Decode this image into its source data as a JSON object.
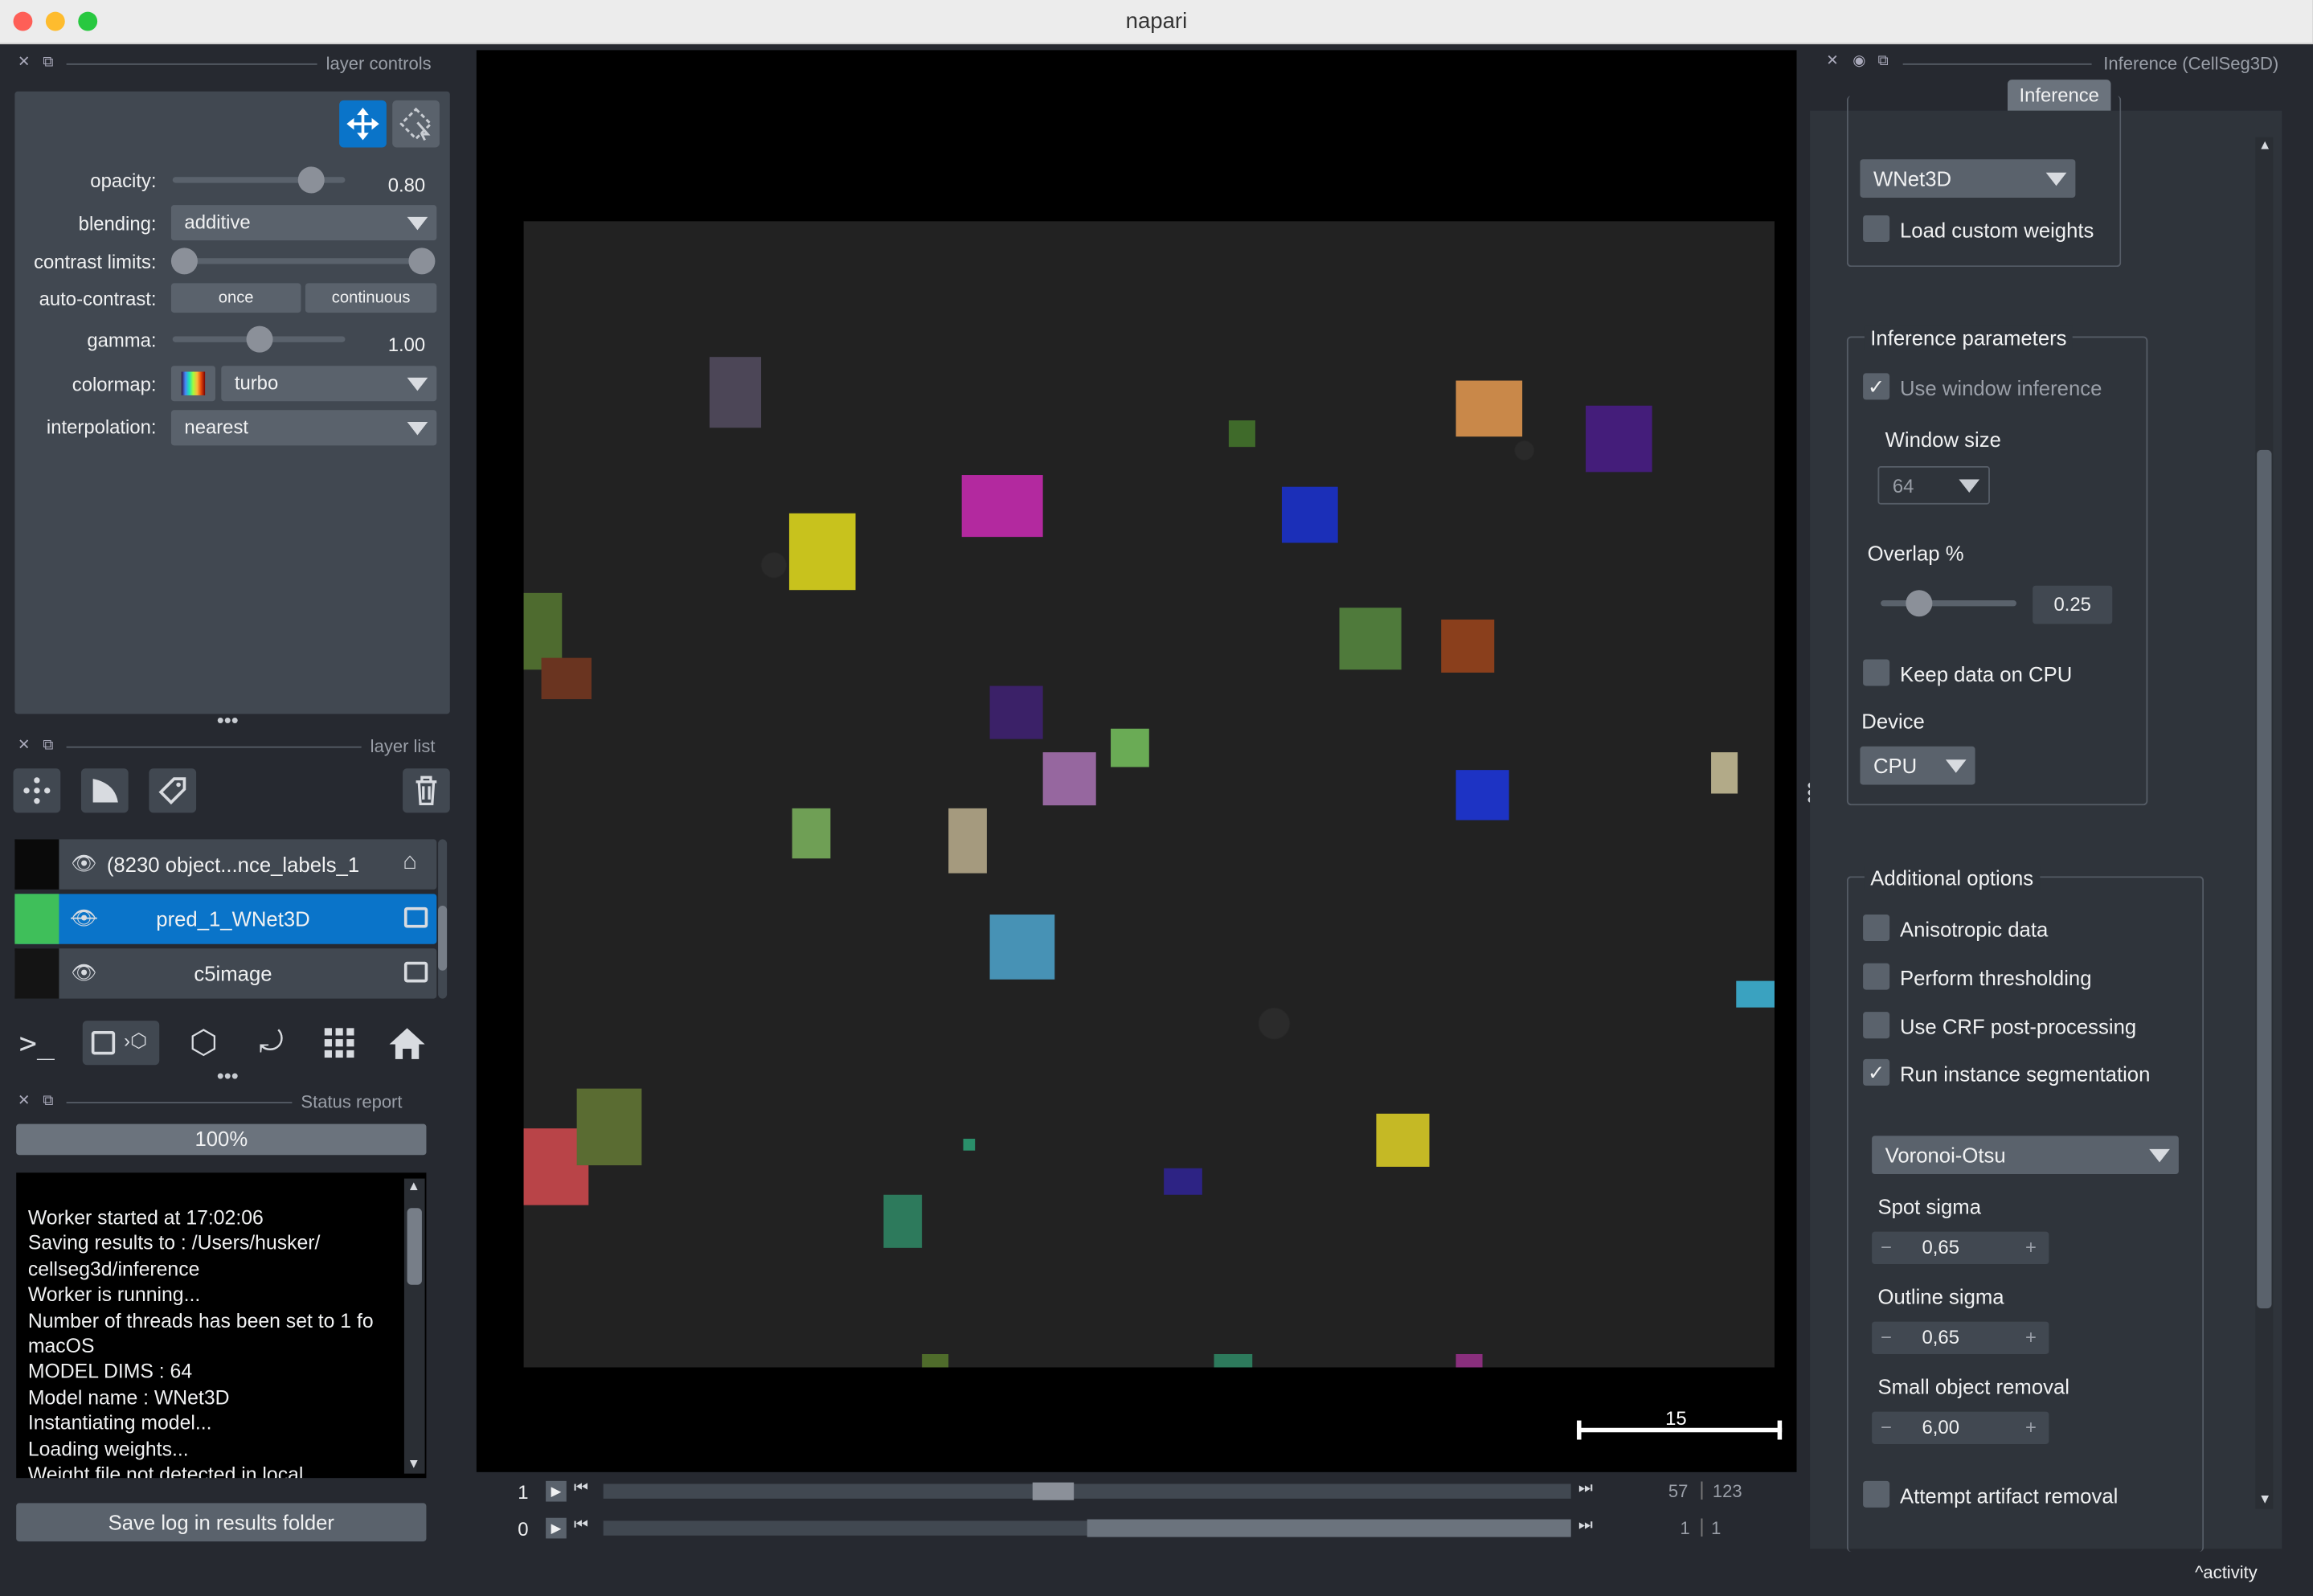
{
  "window": {
    "title": "napari"
  },
  "layer_controls": {
    "header": "layer controls",
    "opacity": {
      "label": "opacity:",
      "value": "0.80",
      "fraction": 0.8
    },
    "blending": {
      "label": "blending:",
      "value": "additive"
    },
    "contrast_limits": {
      "label": "contrast limits:"
    },
    "auto_contrast": {
      "label": "auto-contrast:",
      "once": "once",
      "continuous": "continuous"
    },
    "gamma": {
      "label": "gamma:",
      "value": "1.00",
      "fraction": 0.5
    },
    "colormap": {
      "label": "colormap:",
      "value": "turbo"
    },
    "interpolation": {
      "label": "interpolation:",
      "value": "nearest"
    }
  },
  "layer_list": {
    "header": "layer list",
    "layers": [
      {
        "name": "(8230 object...nce_labels_1",
        "visible": true,
        "selected": false,
        "type_icon": "label-tag-icon"
      },
      {
        "name": "pred_1_WNet3D",
        "visible": false,
        "selected": true,
        "type_icon": "image-icon"
      },
      {
        "name": "c5image",
        "visible": true,
        "selected": false,
        "type_icon": "image-icon"
      }
    ]
  },
  "status_report": {
    "header": "Status report",
    "progress": "100%",
    "progress_value": 1.0,
    "log_lines": [
      "Worker started at 17:02:06",
      "Saving results to : /Users/husker/",
      "cellseg3d/inference",
      "Worker is running...",
      "Number of threads has been set to 1 fo",
      "macOS",
      "MODEL DIMS : 64",
      "Model name : WNet3D",
      "Instantiating model...",
      "Loading weights...",
      "Weight file not detected in local..."
    ],
    "save_button": "Save log in results folder"
  },
  "viewer": {
    "scale_bar": "15",
    "sliders": [
      {
        "axis": "1",
        "current": "57",
        "total": "123",
        "fraction": 0.465
      },
      {
        "axis": "0",
        "current": "1",
        "total": "1",
        "fraction": 1.0
      }
    ]
  },
  "inference_panel": {
    "header": "Inference (CellSeg3D)",
    "tab": "Inference",
    "model": "WNet3D",
    "load_custom_weights": {
      "label": "Load custom weights",
      "checked": false
    },
    "inference_params": {
      "title": "Inference parameters",
      "use_window": {
        "label": "Use window inference",
        "checked": true
      },
      "window_size_label": "Window size",
      "window_size": "64",
      "overlap_label": "Overlap %",
      "overlap": "0.25",
      "keep_cpu": {
        "label": "Keep data on CPU",
        "checked": false
      },
      "device_label": "Device",
      "device": "CPU"
    },
    "additional": {
      "title": "Additional options",
      "anisotropic": {
        "label": "Anisotropic data",
        "checked": false
      },
      "thresholding": {
        "label": "Perform thresholding",
        "checked": false
      },
      "crf": {
        "label": "Use CRF post-processing",
        "checked": false
      },
      "instance": {
        "label": "Run instance segmentation",
        "checked": true
      },
      "method": "Voronoi-Otsu",
      "spot_sigma_label": "Spot sigma",
      "spot_sigma": "0,65",
      "outline_sigma_label": "Outline sigma",
      "outline_sigma": "0,65",
      "small_obj_label": "Small object removal",
      "small_obj": "6,00",
      "artifact": {
        "label": "Attempt artifact removal",
        "checked": false
      }
    }
  },
  "footer": {
    "activity": "activity"
  }
}
